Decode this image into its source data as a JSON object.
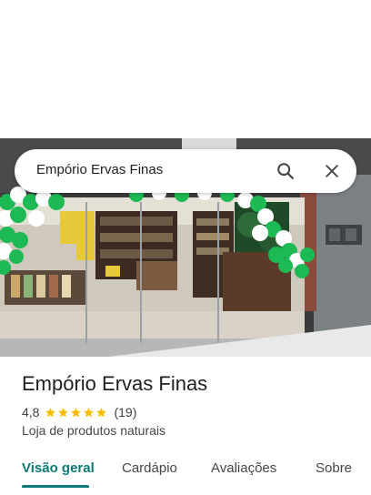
{
  "search": {
    "query": "Empório Ervas Finas"
  },
  "place": {
    "name": "Empório Ervas Finas",
    "rating": "4,8",
    "stars": 5,
    "review_count": "(19)",
    "category": "Loja de produtos naturais"
  },
  "tabs": [
    {
      "label": "Visão geral",
      "active": true
    },
    {
      "label": "Cardápio",
      "active": false
    },
    {
      "label": "Avaliações",
      "active": false
    },
    {
      "label": "Sobre",
      "active": false
    }
  ],
  "colors": {
    "accent": "#0b7a75",
    "star": "#fbbc04"
  }
}
